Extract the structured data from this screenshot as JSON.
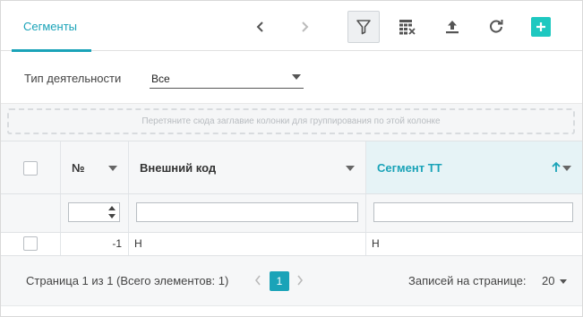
{
  "header": {
    "tab_label": "Сегменты",
    "icons": [
      "chevron-left-icon",
      "chevron-right-icon",
      "filter-icon",
      "table-clear-icon",
      "upload-icon",
      "refresh-icon",
      "plus-icon"
    ]
  },
  "filter": {
    "label": "Тип деятельности",
    "value": "Все"
  },
  "grouping": {
    "placeholder": "Перетяните сюда заглавие колонки для группирования по этой колонке"
  },
  "grid": {
    "columns": [
      "№",
      "Внешний код",
      "Сегмент ТТ"
    ],
    "sorted_column": "Сегмент ТТ",
    "sort_direction": "ascending",
    "rows": [
      {
        "num": "-1",
        "external_code": "Н",
        "segment": "Н"
      }
    ]
  },
  "pager": {
    "info": "Страница 1 из 1 (Всего элементов: 1)",
    "current_page": "1",
    "page_size_label": "Записей на странице:",
    "page_size": "20"
  },
  "colors": {
    "accent": "#1aa3b8",
    "add_button": "#1ec8c0"
  }
}
